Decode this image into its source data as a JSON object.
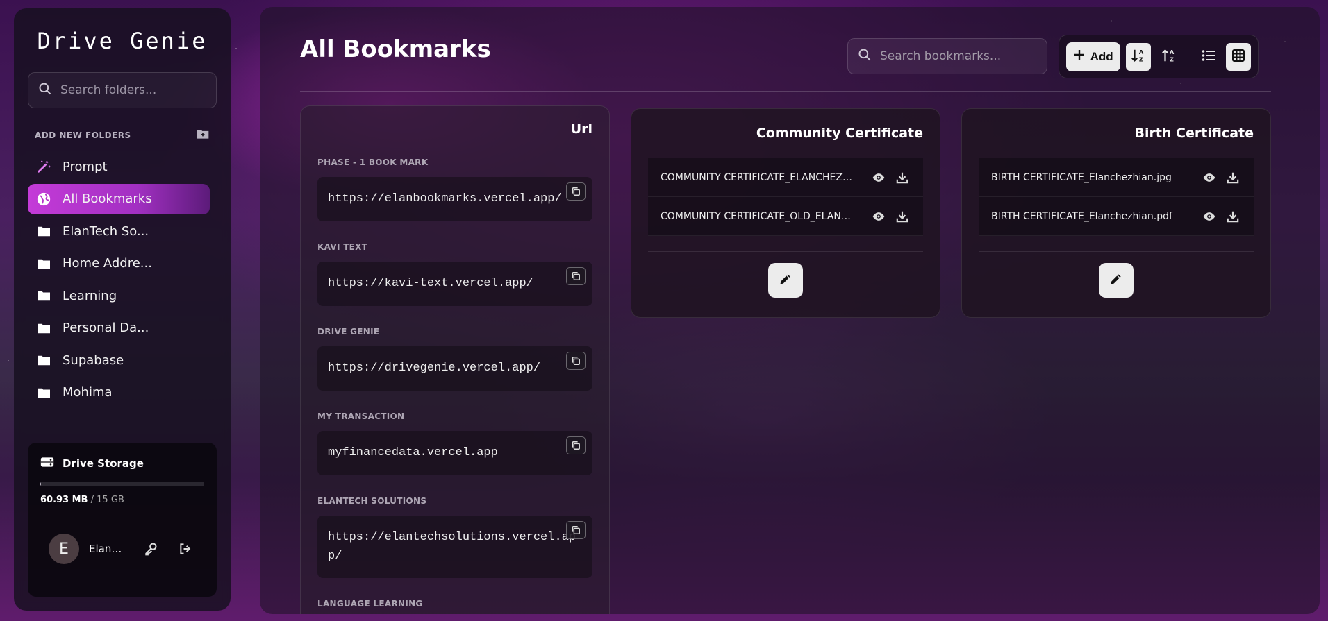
{
  "sidebar": {
    "brand": "Drive Genie",
    "search_placeholder": "Search folders...",
    "add_folders_label": "ADD NEW FOLDERS",
    "items": [
      {
        "label": "Prompt",
        "icon": "magic-wand-icon",
        "active": false
      },
      {
        "label": "All Bookmarks",
        "icon": "globe-icon",
        "active": true
      },
      {
        "label": "ElanTech So...",
        "icon": "folder-icon",
        "active": false
      },
      {
        "label": "Home Addre...",
        "icon": "folder-icon",
        "active": false
      },
      {
        "label": "Learning",
        "icon": "folder-icon",
        "active": false
      },
      {
        "label": "Personal Da...",
        "icon": "folder-icon",
        "active": false
      },
      {
        "label": "Supabase",
        "icon": "folder-icon",
        "active": false
      },
      {
        "label": "Mohima",
        "icon": "folder-icon",
        "active": false
      }
    ],
    "storage": {
      "title": "Drive Storage",
      "used": "60.93 MB",
      "total": "/ 15 GB",
      "used_fraction": 0.004
    },
    "user": {
      "initial": "E",
      "name": "Elanchezhian"
    }
  },
  "main": {
    "title": "All Bookmarks",
    "search_placeholder": "Search bookmarks...",
    "add_label": "Add",
    "url_column": {
      "title": "Url",
      "groups": [
        {
          "label": "PHASE - 1 BOOK MARK",
          "url": "https://elanbookmarks.vercel.app/"
        },
        {
          "label": "KAVI TEXT",
          "url": "https://kavi-text.vercel.app/"
        },
        {
          "label": "DRIVE GENIE",
          "url": "https://drivegenie.vercel.app/"
        },
        {
          "label": "MY TRANSACTION",
          "url": "myfinancedata.vercel.app"
        },
        {
          "label": "ELANTECH SOLUTIONS",
          "url": "https://elantechsolutions.vercel.app/"
        },
        {
          "label": "LANGUAGE LEARNING",
          "url": ""
        }
      ]
    },
    "cards": [
      {
        "title": "Community Certificate",
        "files": [
          {
            "name": "COMMUNITY CERTIFICATE_ELANCHEZHIAN.pdf"
          },
          {
            "name": "COMMUNITY CERTIFICATE_OLD_ELANCHEZHIAN.pdf"
          }
        ]
      },
      {
        "title": "Birth Certificate",
        "files": [
          {
            "name": "BIRTH CERTIFICATE_Elanchezhian.jpg"
          },
          {
            "name": "BIRTH CERTIFICATE_Elanchezhian.pdf"
          }
        ]
      }
    ]
  },
  "colors": {
    "accent": "#c43bd8",
    "panel": "#16101e",
    "button_light": "#ececec"
  }
}
